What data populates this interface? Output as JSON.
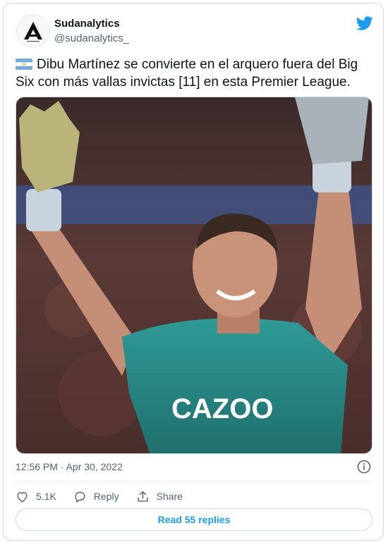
{
  "tweet": {
    "author_name": "Sudanalytics",
    "author_handle": "@sudanalytics_",
    "text": "Dibu Martínez se convierte en el arquero fuera del Big Six con más vallas invictas [11] en esta Premier League.",
    "timestamp": "12:56 PM · Apr 30, 2022",
    "likes": "5.1K",
    "reply_label": "Reply",
    "share_label": "Share",
    "read_replies_label": "Read 55 replies",
    "photo_alt": "Dibu Martínez celebrating with both arms raised",
    "photo_jersey_text": "CAZOO"
  },
  "colors": {
    "accent": "#1d9bf0",
    "text": "#0f1419",
    "secondary": "#536471",
    "border": "#cfd9de",
    "jersey": "#2a8c8a"
  },
  "icons": {
    "avatar": "sudanalytics-logo",
    "brand": "twitter-bird-icon",
    "flag": "argentina-flag-icon",
    "info": "info-icon",
    "like": "heart-icon",
    "reply": "reply-icon",
    "share": "share-icon"
  }
}
